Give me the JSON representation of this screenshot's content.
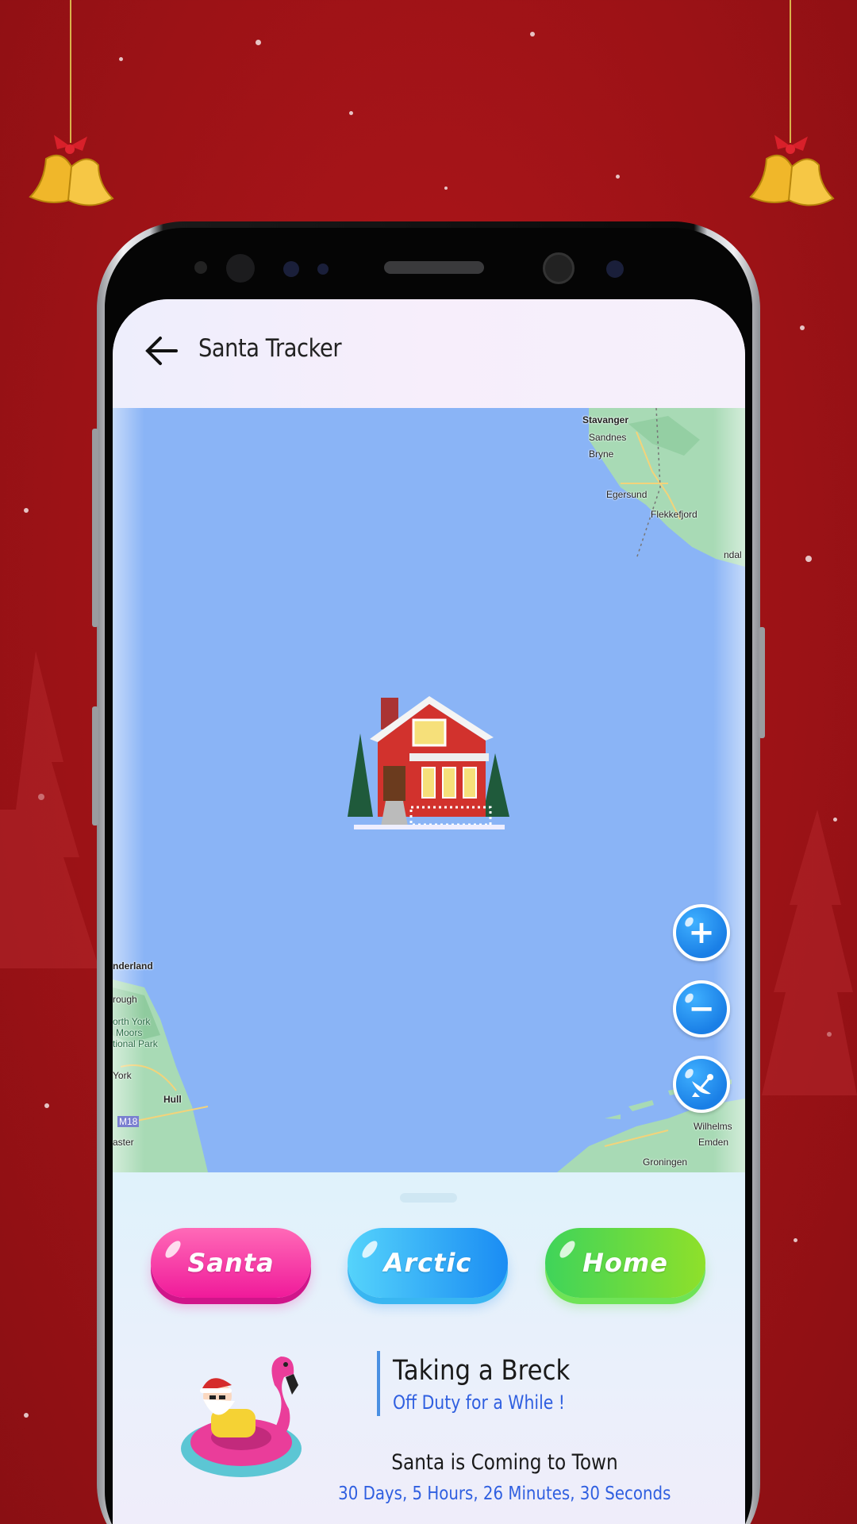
{
  "app": {
    "title": "Santa Tracker",
    "back_icon": "arrow-left-icon"
  },
  "colors": {
    "background": "#9c1216",
    "map_water": "#8ab4f6",
    "land": "#a8dab5",
    "santa_button": "#f01a9a",
    "arctic_button": "#1a8cf3",
    "home_button": "#5fd83a",
    "accent_text": "#2f5fe0"
  },
  "map": {
    "labels": [
      "Stavanger",
      "Sandnes",
      "Bryne",
      "Egersund",
      "Flekkefjord",
      "ndal",
      "nderland",
      "rough",
      "orth York",
      "Moors",
      "tional Park",
      "York",
      "Hull",
      "M18",
      "aster",
      "Groningen",
      "Emden",
      "Wilhelms"
    ],
    "marker": "house-icon",
    "controls": [
      {
        "name": "zoom-in",
        "icon": "plus-icon"
      },
      {
        "name": "zoom-out",
        "icon": "minus-icon"
      },
      {
        "name": "satellite",
        "icon": "satellite-dish-icon"
      }
    ]
  },
  "buttons": {
    "santa": "Santa",
    "arctic": "Arctic",
    "home": "Home"
  },
  "status": {
    "title": "Taking a Breck",
    "subtitle": "Off Duty for a While !",
    "countdown_title": "Santa is Coming to Town",
    "countdown": "30 Days, 5 Hours, 26 Minutes, 30 Seconds"
  }
}
